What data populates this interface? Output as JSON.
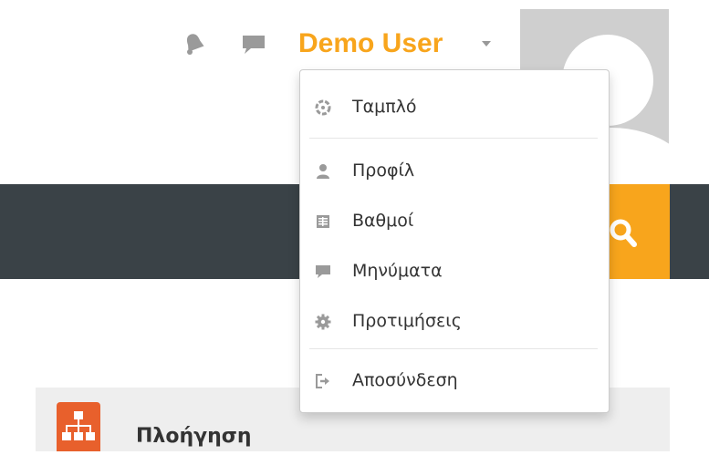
{
  "header": {
    "notifications_icon": "bell-icon",
    "messages_icon": "chat-bubble-icon",
    "user_name": "Demo User",
    "user_menu_caret": "caret-down-icon",
    "avatar_icon": "user-avatar"
  },
  "navbar": {
    "search_icon": "search-icon",
    "accent_color": "#f8a51c",
    "bar_color": "#3a4247"
  },
  "user_menu": {
    "items": [
      {
        "label": "Ταμπλό",
        "icon": "dashboard-icon"
      },
      {
        "label": "Προφίλ",
        "icon": "user-icon"
      },
      {
        "label": "Βαθμοί",
        "icon": "grades-table-icon"
      },
      {
        "label": "Μηνύματα",
        "icon": "chat-bubble-icon"
      },
      {
        "label": "Προτιμήσεις",
        "icon": "gear-icon"
      },
      {
        "label": "Αποσύνδεση",
        "icon": "sign-out-icon"
      }
    ]
  },
  "navigation_block": {
    "title": "Πλοήγηση",
    "icon": "sitemap-icon",
    "icon_color": "#e8602c"
  }
}
